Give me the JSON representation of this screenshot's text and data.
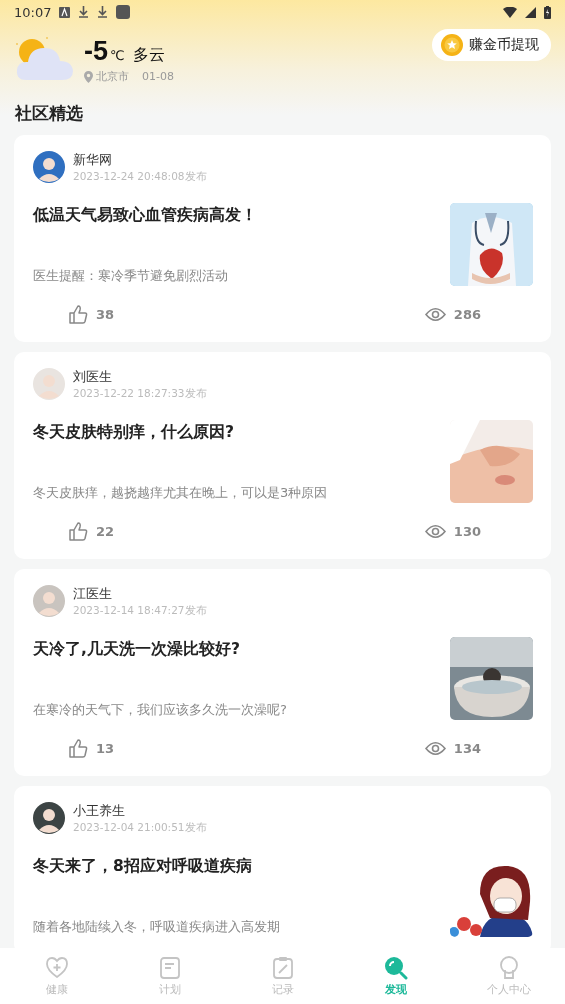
{
  "status_bar": {
    "time": "10:07"
  },
  "weather": {
    "temperature": "-5",
    "unit": "℃",
    "condition": "多云",
    "city": "北京市",
    "date": "01-08"
  },
  "coin_button": {
    "label": "赚金币提现"
  },
  "section_title": "社区精选",
  "posts": [
    {
      "author": "新华网",
      "time": "2023-12-24 20:48:08发布",
      "title": "低温天气易致心血管疾病高发！",
      "summary": "医生提醒：寒冷季节避免剧烈活动",
      "likes": "38",
      "views": "286"
    },
    {
      "author": "刘医生",
      "time": "2023-12-22 18:27:33发布",
      "title": "冬天皮肤特别痒，什么原因?",
      "summary": "冬天皮肤痒，越挠越痒尤其在晚上，可以是3种原因",
      "likes": "22",
      "views": "130"
    },
    {
      "author": "江医生",
      "time": "2023-12-14 18:47:27发布",
      "title": "天冷了,几天洗一次澡比较好?",
      "summary": "在寒冷的天气下，我们应该多久洗一次澡呢?",
      "likes": "13",
      "views": "134"
    },
    {
      "author": "小王养生",
      "time": "2023-12-04 21:00:51发布",
      "title": "冬天来了，8招应对呼吸道疾病",
      "summary": "随着各地陆续入冬，呼吸道疾病进入高发期"
    }
  ],
  "nav": [
    {
      "label": "健康",
      "selected": false
    },
    {
      "label": "计划",
      "selected": false
    },
    {
      "label": "记录",
      "selected": false
    },
    {
      "label": "发现",
      "selected": true
    },
    {
      "label": "个人中心",
      "selected": false
    }
  ]
}
